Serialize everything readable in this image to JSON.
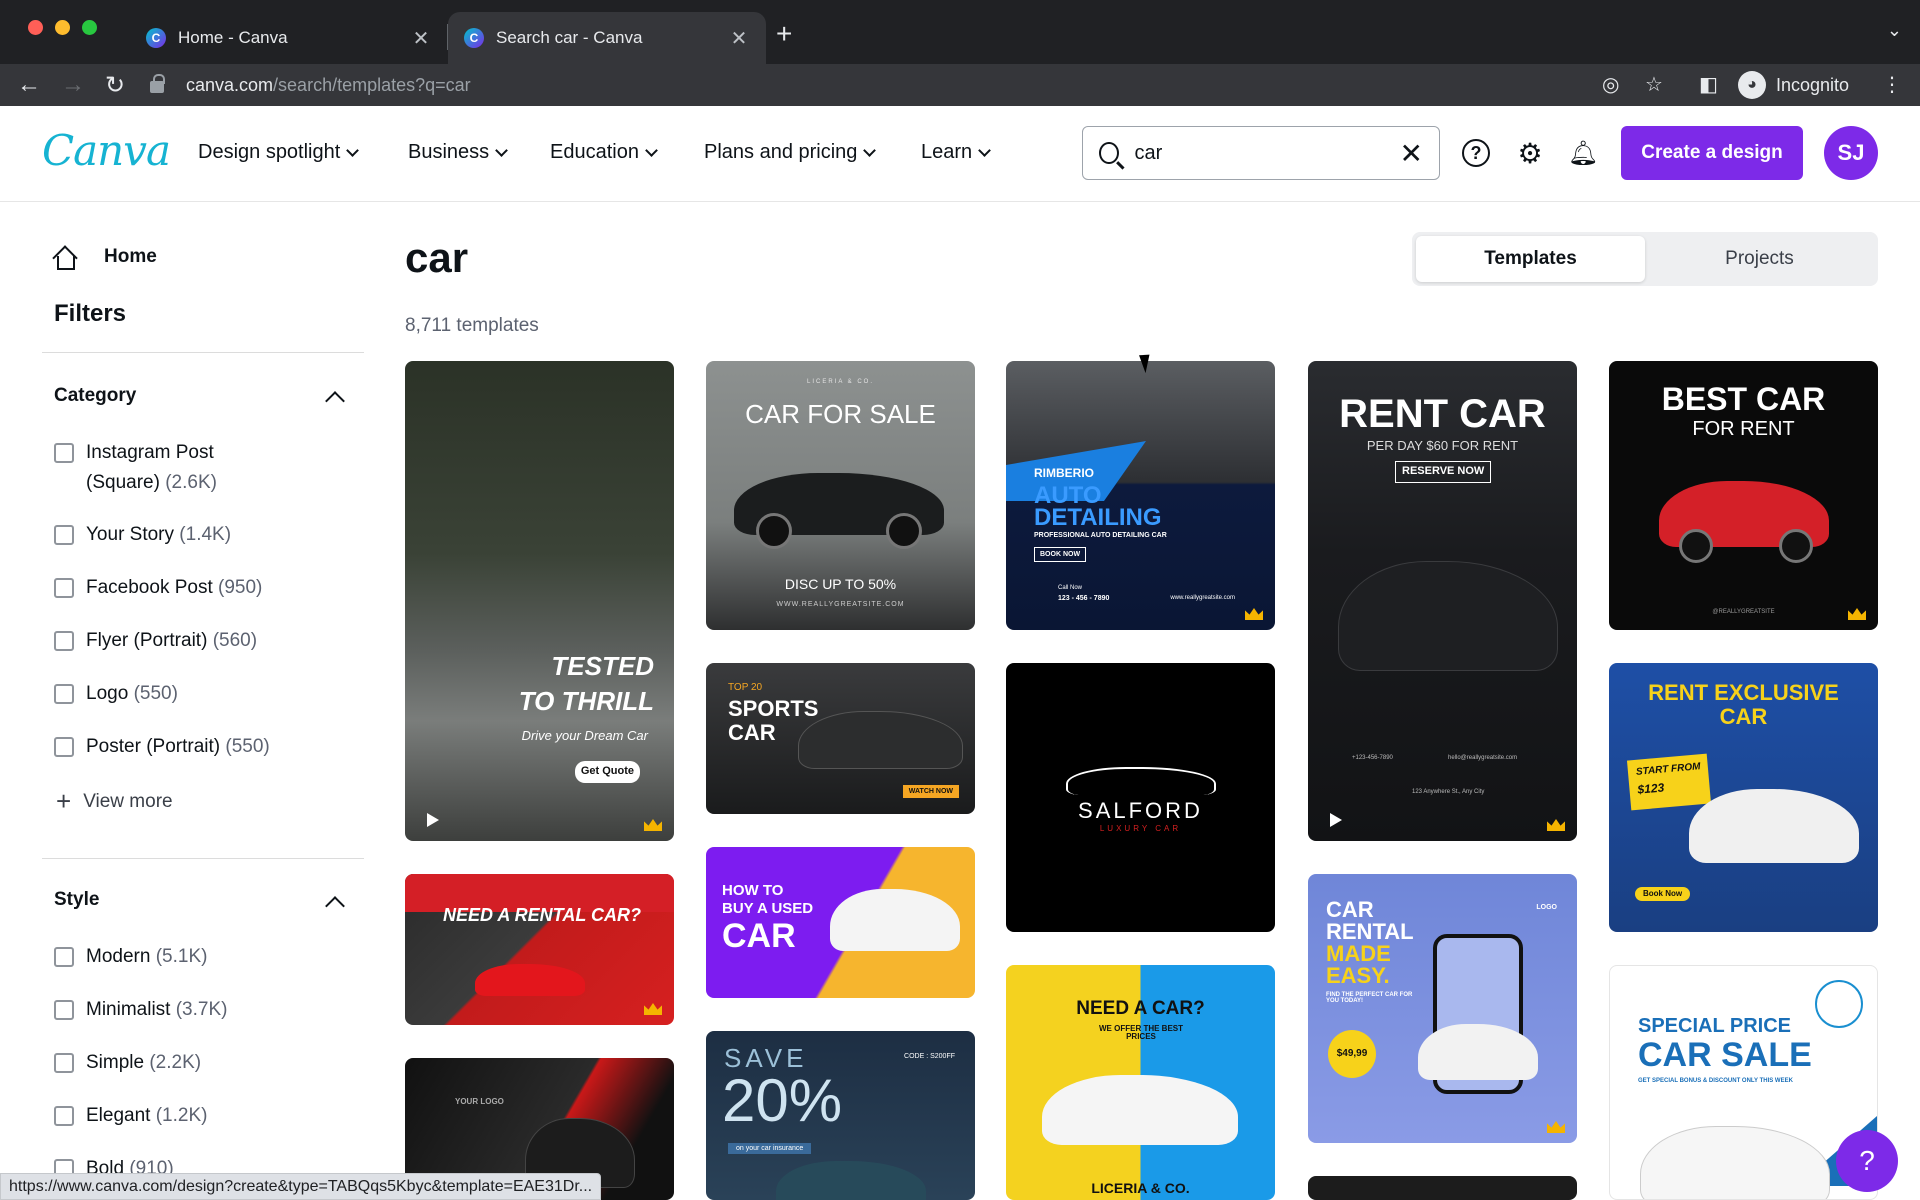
{
  "browser": {
    "tabs": [
      {
        "title": "Home - Canva",
        "close": "✕"
      },
      {
        "title": "Search car - Canva",
        "close": "✕"
      }
    ],
    "new_tab": "+",
    "url_host": "canva.com",
    "url_path": "/search/templates?q=car",
    "profile": "Incognito",
    "status_url": "https://www.canva.com/design?create&type=TABQqs5Kbyc&template=EAE31Dr..."
  },
  "header": {
    "logo": "Canva",
    "nav": [
      "Design spotlight",
      "Business",
      "Education",
      "Plans and pricing",
      "Learn"
    ],
    "search_value": "car",
    "create_label": "Create a design",
    "avatar_initials": "SJ"
  },
  "sidebar": {
    "home": "Home",
    "filters_title": "Filters",
    "category": {
      "title": "Category",
      "items": [
        {
          "label": "Instagram Post",
          "label2": "(Square)",
          "count": "(2.6K)"
        },
        {
          "label": "Your Story",
          "count": "(1.4K)"
        },
        {
          "label": "Facebook Post",
          "count": "(950)"
        },
        {
          "label": "Flyer (Portrait)",
          "count": "(560)"
        },
        {
          "label": "Logo",
          "count": "(550)"
        },
        {
          "label": "Poster (Portrait)",
          "count": "(550)"
        }
      ],
      "view_more": "View more"
    },
    "style": {
      "title": "Style",
      "items": [
        {
          "label": "Modern",
          "count": "(5.1K)"
        },
        {
          "label": "Minimalist",
          "count": "(3.7K)"
        },
        {
          "label": "Simple",
          "count": "(2.2K)"
        },
        {
          "label": "Elegant",
          "count": "(1.2K)"
        },
        {
          "label": "Bold",
          "count": "(910)"
        }
      ]
    }
  },
  "main": {
    "title": "car",
    "count": "8,711 templates",
    "toggle": {
      "templates": "Templates",
      "projects": "Projects"
    },
    "cards": {
      "c1": {
        "l1": "TESTED",
        "l2": "TO THRILL",
        "sub": "Drive your Dream Car",
        "btn": "Get Quote"
      },
      "c2": {
        "top": "LICERIA & CO.",
        "title": "CAR FOR SALE",
        "disc": "DISC UP TO 50%",
        "site": "WWW.REALLYGREATSITE.COM"
      },
      "c3": {
        "brand": "RIMBERIO",
        "l1": "AUTO",
        "l2": "DETAILING",
        "sub": "PROFESSIONAL AUTO DETAILING CAR",
        "btn": "BOOK NOW",
        "call": "Call Now",
        "phone": "123 - 456 - 7890",
        "site": "www.reallygreatsite.com"
      },
      "c4": {
        "title": "RENT CAR",
        "sub": "PER DAY $60  FOR RENT",
        "btn": "RESERVE NOW",
        "p1": "+123-456-7890",
        "p2": "hello@reallygreatsite.com",
        "p3": "123 Anywhere St., Any City"
      },
      "c5": {
        "l1": "BEST CAR",
        "l2": "FOR RENT",
        "site": "@REALLYGREATSITE"
      },
      "c6": {
        "top": "TOP 20",
        "l1": "SPORTS",
        "l2": "CAR",
        "btn": "WATCH NOW"
      },
      "c7": {
        "name": "SALFORD",
        "sub": "LUXURY CAR"
      },
      "c8": {
        "l1": "RENT EXCLUSIVE",
        "l2": "CAR",
        "badge1": "START FROM",
        "badge2": "$123",
        "btn": "Book Now"
      },
      "c9": {
        "title": "NEED A RENTAL CAR?"
      },
      "c10": {
        "l1": "HOW TO",
        "l2": "BUY A USED",
        "l3": "CAR"
      },
      "c11": {
        "l1": "CAR",
        "l2": "RENTAL",
        "l3": "MADE",
        "l4": "EASY.",
        "sub": "FIND THE PERFECT CAR FOR YOU TODAY!",
        "price": "$49,99",
        "logo": "LOGO"
      },
      "c12": {
        "logo": "YOUR LOGO"
      },
      "c13": {
        "l1": "SAVE",
        "l2": "20%",
        "code": "CODE : S200FF",
        "sub": "on your car insurance"
      },
      "c14": {
        "l1": "NEED A CAR?",
        "l2": "WE OFFER THE BEST PRICES",
        "brand": "LICERIA & CO."
      },
      "c15": {
        "l1": "SPECIAL PRICE",
        "l2": "CAR SALE",
        "sub": "GET SPECIAL BONUS & DISCOUNT ONLY THIS WEEK"
      }
    }
  },
  "help_fab": "?",
  "colors": {
    "brand": "#7d2ae8",
    "logo": "#16b3d2"
  }
}
